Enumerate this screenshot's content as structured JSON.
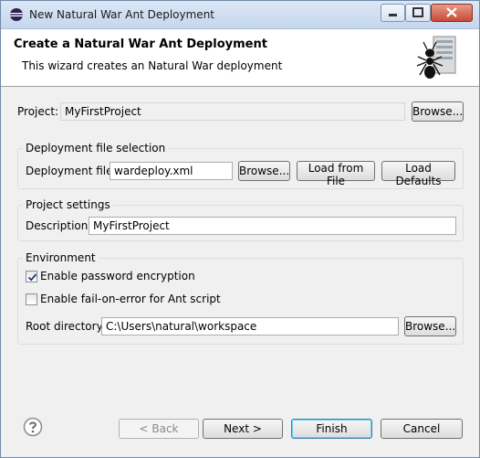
{
  "window": {
    "title": "New Natural War Ant Deployment",
    "icons": {
      "app": "eclipse-icon",
      "minimize": "minimize-icon",
      "maximize": "maximize-icon",
      "close": "close-icon"
    }
  },
  "header": {
    "title": "Create a Natural War Ant Deployment",
    "description": "This wizard creates an Natural War deployment",
    "graphic": "ant-server-icon"
  },
  "project": {
    "label": "Project:",
    "value": "MyFirstProject",
    "browse_label": "Browse..."
  },
  "deployment_group": {
    "title": "Deployment file selection",
    "file_label": "Deployment file:",
    "file_value": "wardeploy.xml",
    "browse_label": "Browse...",
    "load_from_file_label": "Load from File",
    "load_defaults_label": "Load Defaults"
  },
  "project_settings_group": {
    "title": "Project settings",
    "description_label": "Description:",
    "description_value": "MyFirstProject"
  },
  "environment_group": {
    "title": "Environment",
    "password_encryption_label": "Enable password encryption",
    "password_encryption_checked": true,
    "fail_on_error_label": "Enable fail-on-error for Ant script",
    "fail_on_error_checked": false,
    "root_dir_label": "Root directory:",
    "root_dir_value": "C:\\Users\\natural\\workspace",
    "browse_label": "Browse..."
  },
  "footer": {
    "help_icon": "help-icon",
    "back_label": "< Back",
    "next_label": "Next >",
    "finish_label": "Finish",
    "cancel_label": "Cancel"
  }
}
